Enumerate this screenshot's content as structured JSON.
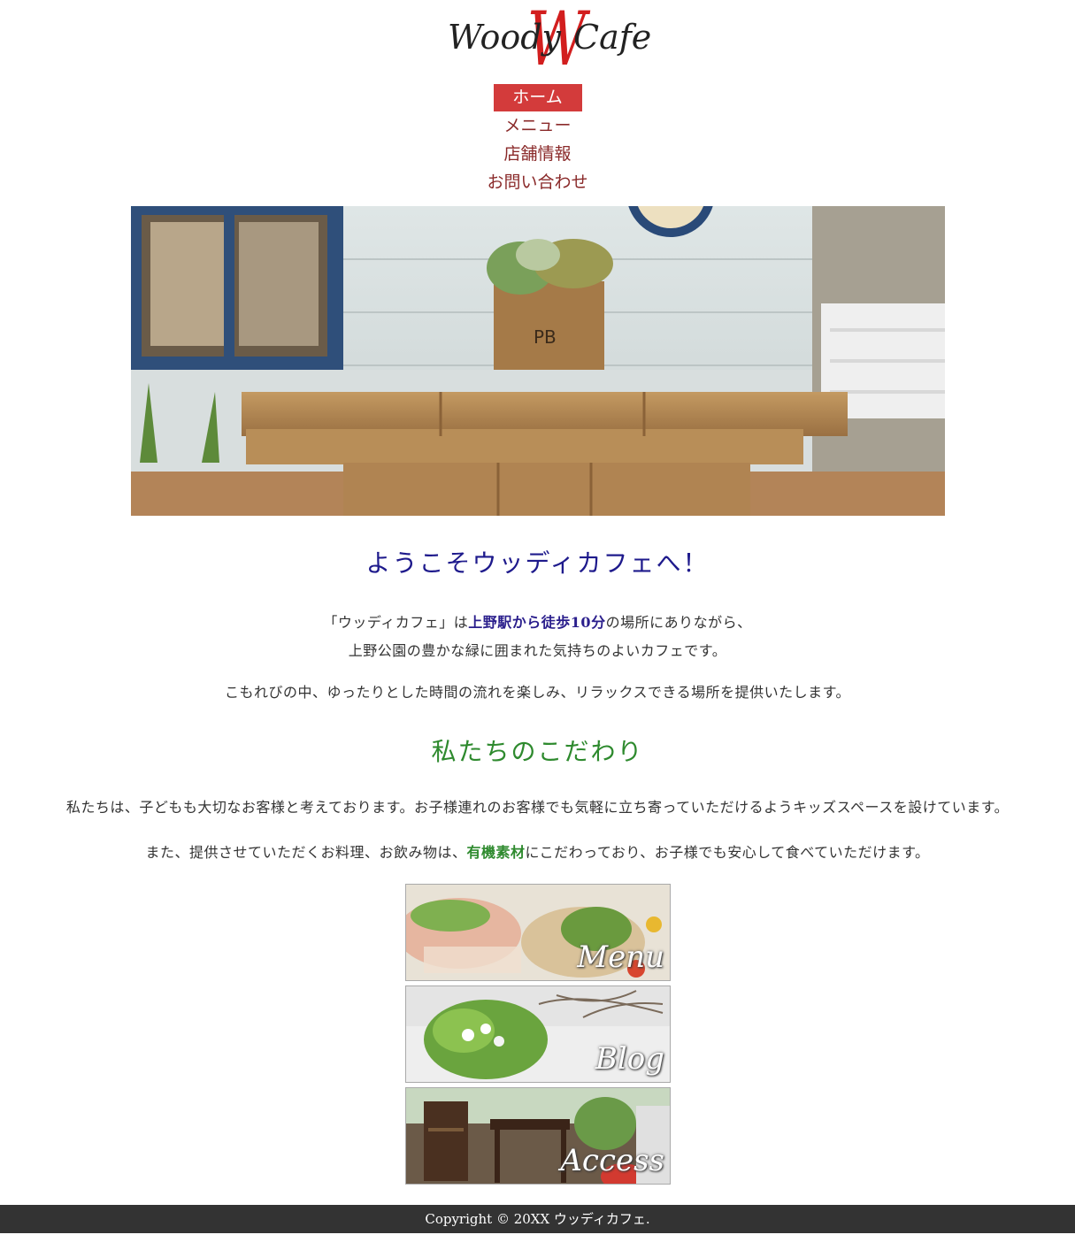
{
  "logo": {
    "left": "Woody",
    "mid": "W",
    "right": "Cafe"
  },
  "nav": {
    "items": [
      "ホーム",
      "メニュー",
      "店舗情報",
      "お問い合わせ"
    ]
  },
  "welcome": {
    "heading": "ようこそウッディカフェへ！",
    "p1_a": "「ウッディカフェ」は",
    "p1_hl": "上野駅から徒歩10分",
    "p1_b": "の場所にありながら、",
    "p1_c": "上野公園の豊かな緑に囲まれた気持ちのよいカフェです。",
    "p2": "こもれびの中、ゆったりとした時間の流れを楽しみ、リラックスできる場所を提供いたします。"
  },
  "kodawari": {
    "heading": "私たちのこだわり",
    "p1": "私たちは、子どもも大切なお客様と考えております。お子様連れのお客様でも気軽に立ち寄っていただけるようキッズスペースを設けています。",
    "p2_a": "また、提供させていただくお料理、お飲み物は、",
    "p2_hl": "有機素材",
    "p2_b": "にこだわっており、お子様でも安心して食べていただけます。"
  },
  "banners": {
    "menu": "Menu",
    "blog": "Blog",
    "access": "Access"
  },
  "footer": {
    "copyright": "Copyright © 20XX ウッディカフェ."
  },
  "colors": {
    "accent_red": "#d33b3b",
    "nav_text": "#8a2a2a",
    "welcome_blue": "#1e1a8c",
    "green": "#2e8a2e",
    "footer_bg": "#333333"
  }
}
